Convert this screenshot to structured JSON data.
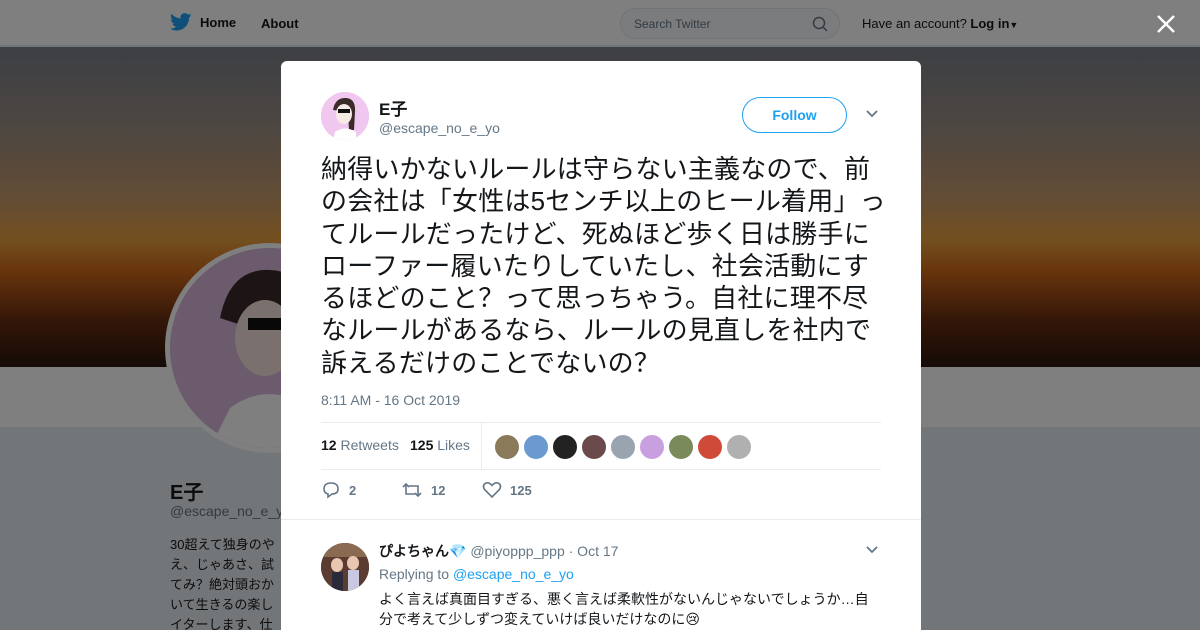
{
  "nav": {
    "home_label": "Home",
    "about_label": "About",
    "search_placeholder": "Search Twitter",
    "account_prompt": "Have an account?",
    "login_label": "Log in"
  },
  "background_profile": {
    "name": "E子",
    "handle": "@escape_no_e_y",
    "bio": "30超えて独身のや\nえ、じゃあさ、試\nてみ？絶対頭おか\nいて生きるの楽し\nイターします、仕"
  },
  "tweet": {
    "author_name": "E子",
    "author_handle": "@escape_no_e_yo",
    "follow_label": "Follow",
    "text": "納得いかないルールは守らない主義なので、前の会社は「女性は5センチ以上のヒール着用」ってルールだったけど、死ぬほど歩く日は勝手にローファー履いたりしていたし、社会活動にするほどのこと？って思っちゃう。自社に理不尽なルールがあるなら、ルールの見直しを社内で訴えるだけのことでないの？",
    "timestamp": "8:11 AM - 16 Oct 2019",
    "retweets_count": "12",
    "retweets_label": "Retweets",
    "likes_count": "125",
    "likes_label": "Likes",
    "replies_action": "2",
    "retweets_action": "12",
    "likes_action": "125",
    "liker_colors": [
      "#8a7a5a",
      "#6a9ad0",
      "#222222",
      "#6a4a4a",
      "#9aa4b0",
      "#c8a0e0",
      "#7a8a5a",
      "#d04a3a",
      "#b0b0b0"
    ]
  },
  "reply": {
    "name": "ぴよちゃん💎",
    "handle": "@piyoppp_ppp",
    "date": "· Oct 17",
    "replying_to_label": "Replying to",
    "replying_to_handle": "@escape_no_e_yo",
    "text": "よく言えば真面目すぎる、悪く言えば柔軟性がないんじゃないでしょうか…自分で考えて少しずつ変えていけば良いだけなのに😢"
  },
  "colors": {
    "brand_blue": "#1da1f2",
    "text_secondary": "#657786",
    "overlay": "rgba(0,0,0,0.5)"
  }
}
